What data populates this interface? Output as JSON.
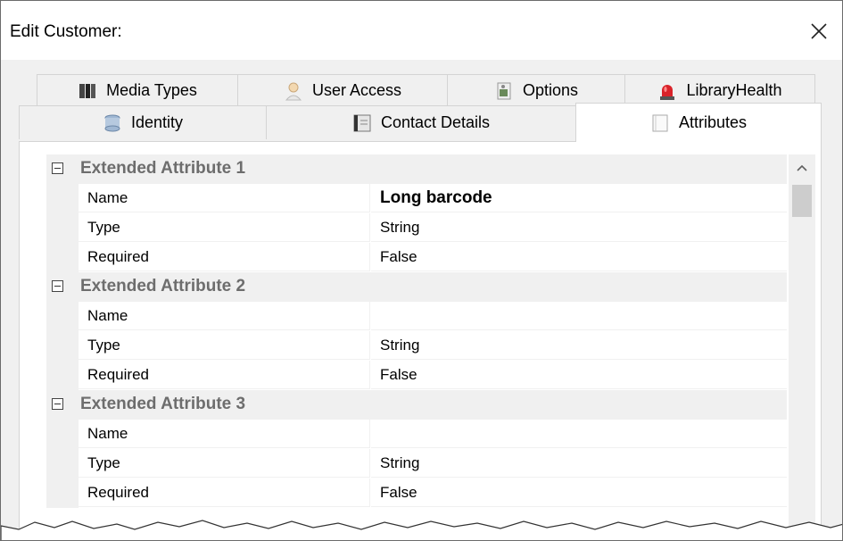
{
  "window": {
    "title": "Edit Customer:"
  },
  "tabs": {
    "row1": [
      {
        "label": "Media Types",
        "icon": "media-types-icon"
      },
      {
        "label": "User Access",
        "icon": "user-icon"
      },
      {
        "label": "Options",
        "icon": "options-icon"
      },
      {
        "label": "LibraryHealth",
        "icon": "alarm-light-icon"
      }
    ],
    "row2": [
      {
        "label": "Identity",
        "icon": "identity-icon"
      },
      {
        "label": "Contact Details",
        "icon": "contact-card-icon"
      },
      {
        "label": "Attributes",
        "icon": "attributes-icon",
        "active": true
      }
    ]
  },
  "grid": {
    "categories": [
      {
        "label": "Extended Attribute 1",
        "expanded": true,
        "properties": [
          {
            "name": "Name",
            "value": "Long barcode"
          },
          {
            "name": "Type",
            "value": "String"
          },
          {
            "name": "Required",
            "value": "False"
          }
        ]
      },
      {
        "label": "Extended Attribute 2",
        "expanded": true,
        "properties": [
          {
            "name": "Name",
            "value": ""
          },
          {
            "name": "Type",
            "value": "String"
          },
          {
            "name": "Required",
            "value": "False"
          }
        ]
      },
      {
        "label": "Extended Attribute 3",
        "expanded": true,
        "properties": [
          {
            "name": "Name",
            "value": ""
          },
          {
            "name": "Type",
            "value": "String"
          },
          {
            "name": "Required",
            "value": "False"
          }
        ]
      }
    ]
  },
  "colors": {
    "dialog_bg": "#f0f0f0",
    "category_text": "#6d6d6d",
    "border": "#d4d4d4",
    "scroll_thumb": "#cdcdcd"
  }
}
